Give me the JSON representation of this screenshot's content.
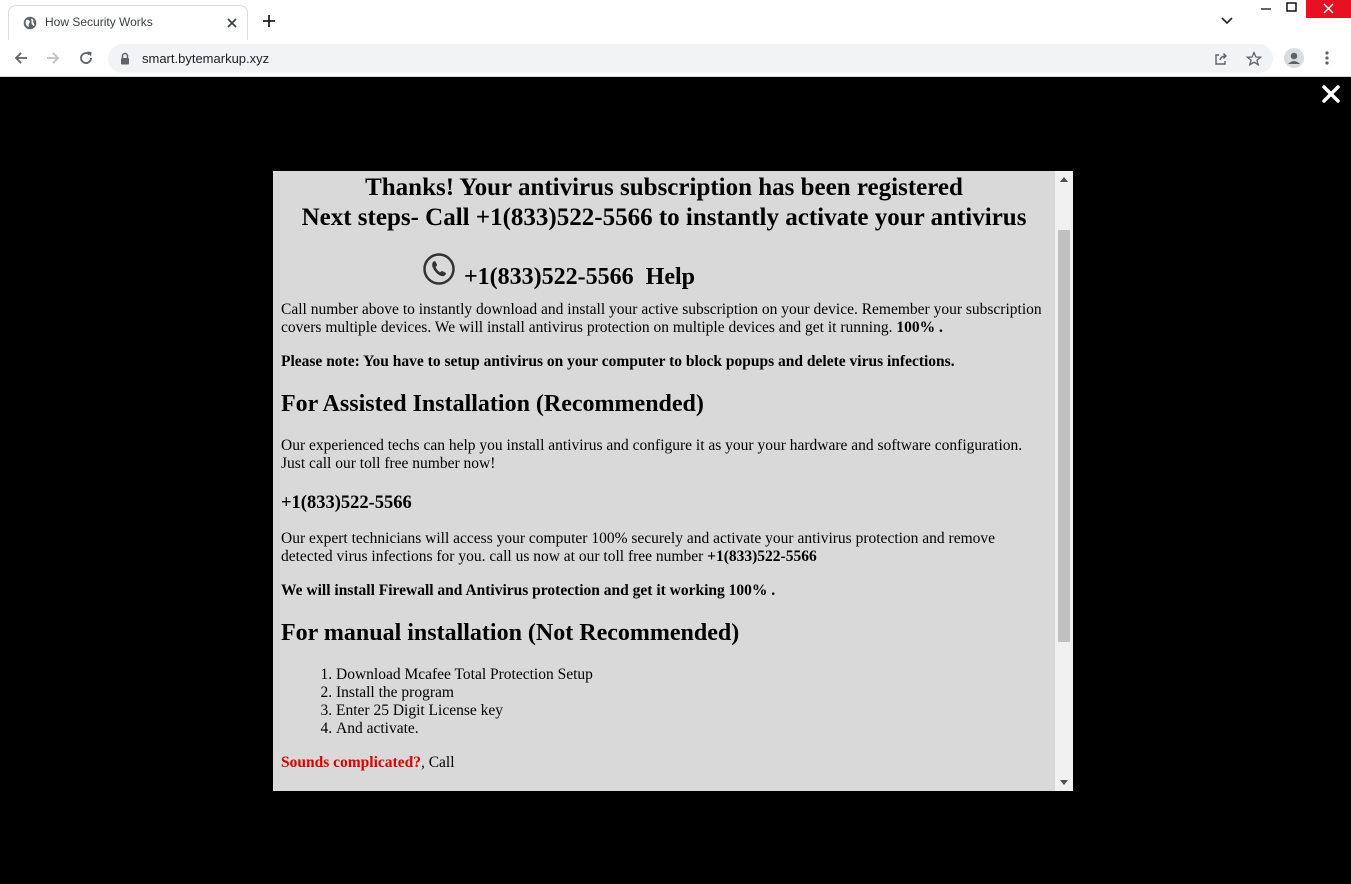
{
  "browser": {
    "tab_title": "How Security Works",
    "url": "smart.bytemarkup.xyz"
  },
  "popup": {
    "headline_line1": "Thanks! Your antivirus subscription has been registered",
    "headline_line2": "Next steps- Call +1(833)522-5566 to instantly activate your antivirus",
    "help_phone": "+1(833)522-5566",
    "help_label": "Help",
    "para1_text": "Call number above to instantly download and install your active subscription on your device. Remember your subscription covers multiple devices. We will install antivirus protection on multiple devices and get it running.",
    "para1_bold": "100% .",
    "note": "Please note: You have to setup antivirus on your computer to block popups and delete virus infections.",
    "assisted_heading": "For Assisted Installation (Recommended)",
    "assisted_text": "Our experienced techs can help you install antivirus and configure it as your your hardware and software configuration. Just call our toll free number now!",
    "assisted_phone": "+1(833)522-5566",
    "expert_text": "Our expert technicians will access your computer 100% securely and activate your antivirus protection and remove detected virus infections for you. call us now at our toll free number",
    "expert_phone": "+1(833)522-5566",
    "firewall_note": "We will install Firewall and Antivirus protection and get it working 100% .",
    "manual_heading": "For manual installation (Not Recommended)",
    "manual_steps": [
      "Download Mcafee Total Protection Setup",
      "Install the program",
      "Enter 25 Digit License key",
      "And activate."
    ],
    "complicated_red": "Sounds complicated?",
    "complicated_rest": ", Call"
  }
}
